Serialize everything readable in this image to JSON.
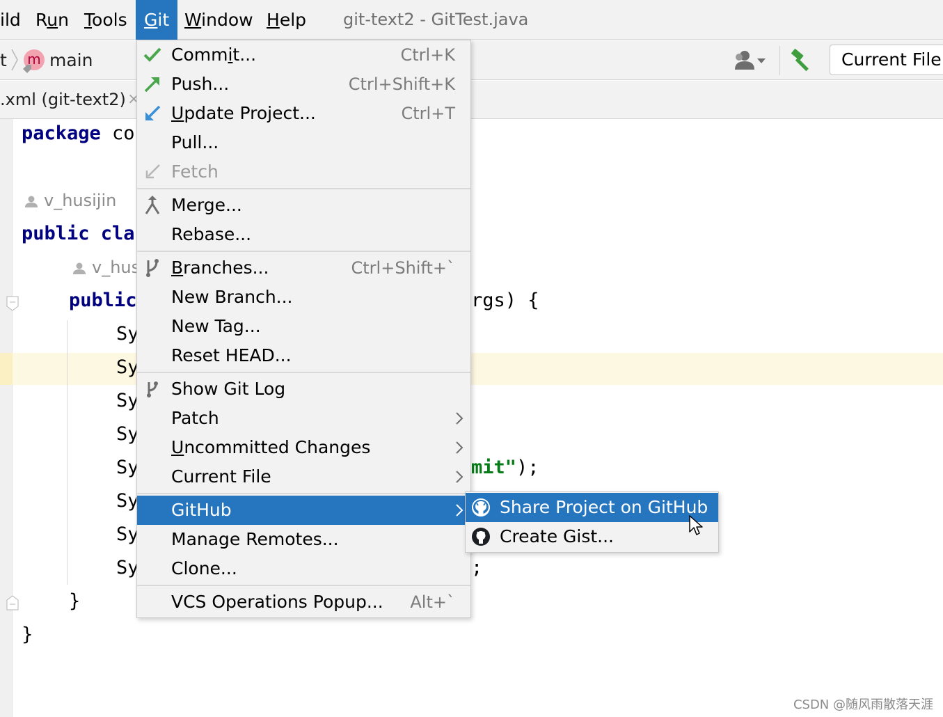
{
  "menubar": {
    "items": [
      {
        "label": "ild",
        "underline": ""
      },
      {
        "label": "Run",
        "underline": "u"
      },
      {
        "label": "Tools",
        "underline": "T"
      },
      {
        "label": "Git",
        "underline": "G"
      },
      {
        "label": "Window",
        "underline": "W"
      },
      {
        "label": "Help",
        "underline": "H"
      }
    ],
    "window_title": "git-text2 - GitTest.java"
  },
  "navbar": {
    "crumb_start": "t",
    "branch_badge": "m",
    "branch": "main",
    "run_config": "Current File"
  },
  "tabbar": {
    "tab_label": ".xml (git-text2)",
    "close_glyph": "×"
  },
  "editor": {
    "line_package_kw": "package",
    "line_package_rest": " co",
    "author_1": "v_husijin",
    "line_class_kw": "public cla",
    "author_2": "v_hus",
    "line_method_kw": "public",
    "line_method_tail": "rgs) {",
    "sys_prefix": "Sy",
    "commit_str": "mit\"",
    "commit_tail": ");",
    "semicolon": ";",
    "inner_brace": "}",
    "outer_brace": "}"
  },
  "git_menu": {
    "items": [
      {
        "name": "commit",
        "pre": "Comm",
        "u": "i",
        "post": "t...",
        "shortcut": "Ctrl+K",
        "icon": "checkmark-icon",
        "icon_color": "#4aa64a"
      },
      {
        "name": "push",
        "pre": "",
        "u": "",
        "post": "Push...",
        "shortcut": "Ctrl+Shift+K",
        "icon": "push-arrow-icon",
        "icon_color": "#4aa64a"
      },
      {
        "name": "update-project",
        "pre": "",
        "u": "U",
        "post": "pdate Project...",
        "shortcut": "Ctrl+T",
        "icon": "update-arrow-icon",
        "icon_color": "#3b8fd6"
      },
      {
        "name": "pull",
        "pre": "",
        "u": "",
        "post": "Pull...",
        "shortcut": "",
        "icon": "",
        "icon_color": ""
      },
      {
        "name": "fetch",
        "pre": "",
        "u": "",
        "post": "Fetch",
        "shortcut": "",
        "icon": "fetch-icon",
        "icon_color": "#b5b5b5",
        "disabled": true
      },
      {
        "name": "merge",
        "pre": "",
        "u": "",
        "post": "Merge...",
        "shortcut": "",
        "icon": "merge-icon",
        "icon_color": "#6e6e6e"
      },
      {
        "name": "rebase",
        "pre": "",
        "u": "",
        "post": "Rebase...",
        "shortcut": "",
        "icon": "",
        "icon_color": ""
      },
      {
        "name": "branches",
        "pre": "",
        "u": "B",
        "post": "ranches...",
        "shortcut": "Ctrl+Shift+`",
        "icon": "branch-icon",
        "icon_color": "#6e6e6e"
      },
      {
        "name": "new-branch",
        "pre": "",
        "u": "",
        "post": "New Branch...",
        "shortcut": "",
        "icon": "",
        "icon_color": ""
      },
      {
        "name": "new-tag",
        "pre": "",
        "u": "",
        "post": "New Tag...",
        "shortcut": "",
        "icon": "",
        "icon_color": ""
      },
      {
        "name": "reset-head",
        "pre": "",
        "u": "",
        "post": "Reset HEAD...",
        "shortcut": "",
        "icon": "",
        "icon_color": ""
      },
      {
        "name": "show-git-log",
        "pre": "",
        "u": "",
        "post": "Show Git Log",
        "shortcut": "",
        "icon": "git-log-icon",
        "icon_color": "#6e6e6e"
      },
      {
        "name": "patch",
        "pre": "",
        "u": "",
        "post": "Patch",
        "shortcut": "",
        "icon": "",
        "icon_color": "",
        "submenu": true
      },
      {
        "name": "uncommitted-changes",
        "pre": "",
        "u": "U",
        "post": "ncommitted Changes",
        "shortcut": "",
        "icon": "",
        "icon_color": "",
        "submenu": true
      },
      {
        "name": "current-file",
        "pre": "",
        "u": "",
        "post": "Current File",
        "shortcut": "",
        "icon": "",
        "icon_color": "",
        "submenu": true
      },
      {
        "name": "github",
        "pre": "",
        "u": "",
        "post": "GitHub",
        "shortcut": "",
        "icon": "",
        "icon_color": "",
        "submenu": true,
        "selected": true
      },
      {
        "name": "manage-remotes",
        "pre": "",
        "u": "",
        "post": "Manage Remotes...",
        "shortcut": "",
        "icon": "",
        "icon_color": ""
      },
      {
        "name": "clone",
        "pre": "",
        "u": "",
        "post": "Clone...",
        "shortcut": "",
        "icon": "",
        "icon_color": ""
      },
      {
        "name": "vcs-operations-popup",
        "pre": "",
        "u": "",
        "post": "VCS Operations Popup...",
        "shortcut": "Alt+`",
        "icon": "",
        "icon_color": ""
      }
    ]
  },
  "github_submenu": {
    "items": [
      {
        "name": "share-project-on-github",
        "label": "Share Project on GitHub",
        "icon": "github-icon",
        "selected": true
      },
      {
        "name": "create-gist",
        "label": "Create Gist...",
        "icon": "github-icon",
        "selected": false
      }
    ]
  },
  "watermark": "CSDN @随风雨散落天涯",
  "colors": {
    "selection": "#2675bf",
    "menu_bg": "#f2f2f2",
    "keyword": "#000080",
    "string": "#067d17",
    "current_line": "#fdf8e2"
  }
}
